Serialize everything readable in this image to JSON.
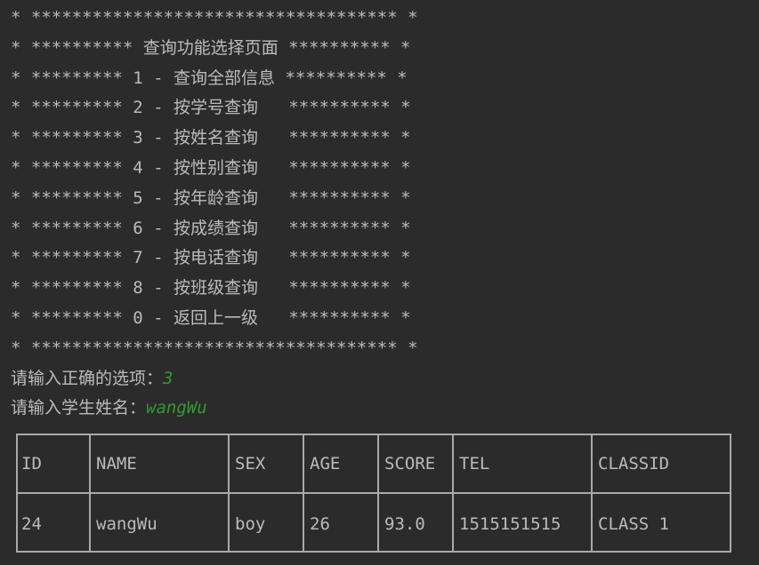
{
  "console": {
    "lines": [
      "* ************************************ *",
      "* ********** 查询功能选择页面 ********** *",
      "* ********* 1 - 查询全部信息 ********** *",
      "* ********* 2 - 按学号查询   ********** *",
      "* ********* 3 - 按姓名查询   ********** *",
      "* ********* 4 - 按性别查询   ********** *",
      "* ********* 5 - 按年龄查询   ********** *",
      "* ********* 6 - 按成绩查询   ********** *",
      "* ********* 7 - 按电话查询   ********** *",
      "* ********* 8 - 按班级查询   ********** *",
      "* ********* 0 - 返回上一级   ********** *",
      "* ************************************ *"
    ],
    "prompt_option": "请输入正确的选项：",
    "option_input": "3",
    "prompt_name": "请输入学生姓名：",
    "name_input": "wangWu"
  },
  "table": {
    "headers": [
      "ID",
      "NAME",
      "SEX",
      "AGE",
      "SCORE",
      "TEL",
      "CLASSID"
    ],
    "rows": [
      [
        "24",
        "wangWu",
        "boy",
        "26",
        "93.0",
        "1515151515",
        "CLASS 1"
      ]
    ]
  },
  "colors": {
    "background": "#2b2b2b",
    "text": "#bbbbbb",
    "user_input": "#2f9c2f",
    "table_border": "#a9a9a9"
  }
}
